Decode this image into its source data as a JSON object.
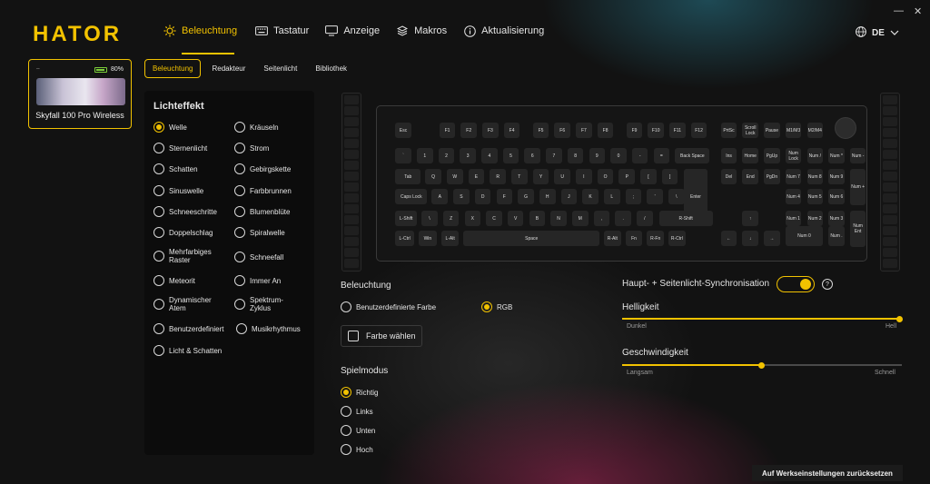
{
  "app": {
    "logo": "HATOR"
  },
  "nav": {
    "items": [
      {
        "label": "Beleuchtung",
        "icon": "sun-icon",
        "active": true
      },
      {
        "label": "Tastatur",
        "icon": "keyboard-icon"
      },
      {
        "label": "Anzeige",
        "icon": "monitor-icon"
      },
      {
        "label": "Makros",
        "icon": "layers-icon"
      },
      {
        "label": "Aktualisierung",
        "icon": "info-icon"
      }
    ],
    "language": "DE"
  },
  "window": {
    "minimize": "—",
    "close": "✕"
  },
  "device": {
    "battery": "80%",
    "name": "Skyfall 100 Pro Wireless"
  },
  "subtabs": [
    "Beleuchtung",
    "Redakteur",
    "Seitenlicht",
    "Bibliothek"
  ],
  "effects": {
    "title": "Lichteffekt",
    "items": [
      "Welle",
      "Kräuseln",
      "Sternenlicht",
      "Strom",
      "Schatten",
      "Gebirgskette",
      "Sinuswelle",
      "Farbbrunnen",
      "Schneeschritte",
      "Blumenblüte",
      "Doppelschlag",
      "Spiralwelle",
      "Mehrfarbiges Raster",
      "Schneefall",
      "Meteorit",
      "Immer An",
      "Dynamischer Atem",
      "Spektrum-Zyklus",
      "Benutzerdefiniert",
      "Musikrhythmus",
      "Licht & Schatten"
    ],
    "selected": "Welle"
  },
  "keyboard": {
    "rows": [
      [
        "Esc",
        "F1",
        "F2",
        "F3",
        "F4",
        "F5",
        "F6",
        "F7",
        "F8",
        "F9",
        "F10",
        "F11",
        "F12",
        "PrtSc",
        "Scroll Lock",
        "Pause",
        "M1/M3",
        "M2/M4"
      ],
      [
        "`",
        "1",
        "2",
        "3",
        "4",
        "5",
        "6",
        "7",
        "8",
        "9",
        "0",
        "-",
        "=",
        "Back Space",
        "Ins",
        "Home",
        "PgUp",
        "Num Lock",
        "Num /",
        "Num *",
        "Num -"
      ],
      [
        "Tab",
        "Q",
        "W",
        "E",
        "R",
        "T",
        "Y",
        "U",
        "I",
        "O",
        "P",
        "[",
        "]",
        "Enter",
        "Del",
        "End",
        "PgDn",
        "Num 7",
        "Num 8",
        "Num 9",
        "Num +"
      ],
      [
        "Caps Lock",
        "A",
        "S",
        "D",
        "F",
        "G",
        "H",
        "J",
        "K",
        "L",
        ";",
        "'",
        "\\",
        "Num 4",
        "Num 5",
        "Num 6"
      ],
      [
        "L-Shift",
        "\\",
        "Z",
        "X",
        "C",
        "V",
        "B",
        "N",
        "M",
        ",",
        ".",
        "/",
        "R-Shift",
        "↑",
        "Num 1",
        "Num 2",
        "Num 3",
        "Num Ent"
      ],
      [
        "L-Ctrl",
        "Win",
        "L-Alt",
        "Space",
        "R-Alt",
        "Fn",
        "R-Fn",
        "R-Ctrl",
        "←",
        "↓",
        "→",
        "Num 0",
        "Num ."
      ]
    ]
  },
  "lighting": {
    "title": "Beleuchtung",
    "options": [
      "Benutzerdefinierte Farbe",
      "RGB"
    ],
    "selected": "RGB",
    "pick_color": "Farbe wählen"
  },
  "playmode": {
    "title": "Spielmodus",
    "options": [
      "Richtig",
      "Links",
      "Unten",
      "Hoch"
    ],
    "selected": "Richtig"
  },
  "sync": {
    "label": "Haupt- + Seitenlicht-Synchronisation",
    "on": true,
    "help": "?"
  },
  "brightness": {
    "label": "Helligkeit",
    "min": "Dunkel",
    "max": "Hell",
    "value": 1.0
  },
  "speed": {
    "label": "Geschwindigkeit",
    "min": "Langsam",
    "max": "Schnell",
    "value": 0.5
  },
  "reset": "Auf Werkseinstellungen zurücksetzen",
  "colors": {
    "accent": "#f2c200",
    "battery": "#7ccf3a"
  }
}
